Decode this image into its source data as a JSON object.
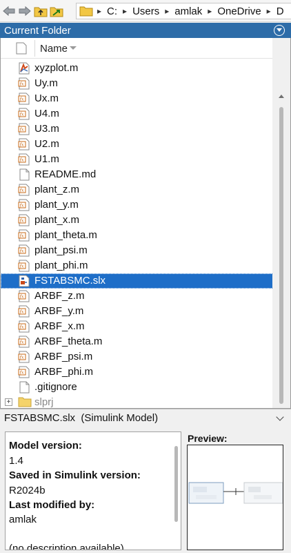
{
  "toolbar": {
    "icons": [
      "back-arrow-icon",
      "forward-arrow-icon",
      "up-folder-icon",
      "browse-folder-icon",
      "folder-icon"
    ]
  },
  "address": {
    "segments": [
      "C:",
      "Users",
      "amlak",
      "OneDrive",
      "D"
    ]
  },
  "panel": {
    "title": "Current Folder"
  },
  "file_list": {
    "column_name": "Name",
    "files": [
      {
        "name": "xyzplot.m",
        "type": "plot-m"
      },
      {
        "name": "Uy.m",
        "type": "function"
      },
      {
        "name": "Ux.m",
        "type": "function"
      },
      {
        "name": "U4.m",
        "type": "function"
      },
      {
        "name": "U3.m",
        "type": "function"
      },
      {
        "name": "U2.m",
        "type": "function"
      },
      {
        "name": "U1.m",
        "type": "function"
      },
      {
        "name": "README.md",
        "type": "document"
      },
      {
        "name": "plant_z.m",
        "type": "function"
      },
      {
        "name": "plant_y.m",
        "type": "function"
      },
      {
        "name": "plant_x.m",
        "type": "function"
      },
      {
        "name": "plant_theta.m",
        "type": "function"
      },
      {
        "name": "plant_psi.m",
        "type": "function"
      },
      {
        "name": "plant_phi.m",
        "type": "function"
      },
      {
        "name": "FSTABSMC.slx",
        "type": "simulink",
        "selected": true
      },
      {
        "name": "ARBF_z.m",
        "type": "function"
      },
      {
        "name": "ARBF_y.m",
        "type": "function"
      },
      {
        "name": "ARBF_x.m",
        "type": "function"
      },
      {
        "name": "ARBF_theta.m",
        "type": "function"
      },
      {
        "name": "ARBF_psi.m",
        "type": "function"
      },
      {
        "name": "ARBF_phi.m",
        "type": "function"
      },
      {
        "name": ".gitignore",
        "type": "document"
      },
      {
        "name": "slprj",
        "type": "folder",
        "expander": "+"
      }
    ]
  },
  "details": {
    "header": "FSTABSMC.slx  (Simulink Model)",
    "model_version_label": "Model version:",
    "model_version": "1.4",
    "saved_in_label": "Saved in Simulink version:",
    "saved_in": "R2024b",
    "last_modified_label": "Last modified by:",
    "last_modified": "amlak",
    "description": "(no description available)",
    "preview_label": "Preview:"
  },
  "colors": {
    "header_blue": "#2d6ca8",
    "selection_blue": "#1e6ec8",
    "function_icon_accent": "#c96b1a"
  }
}
